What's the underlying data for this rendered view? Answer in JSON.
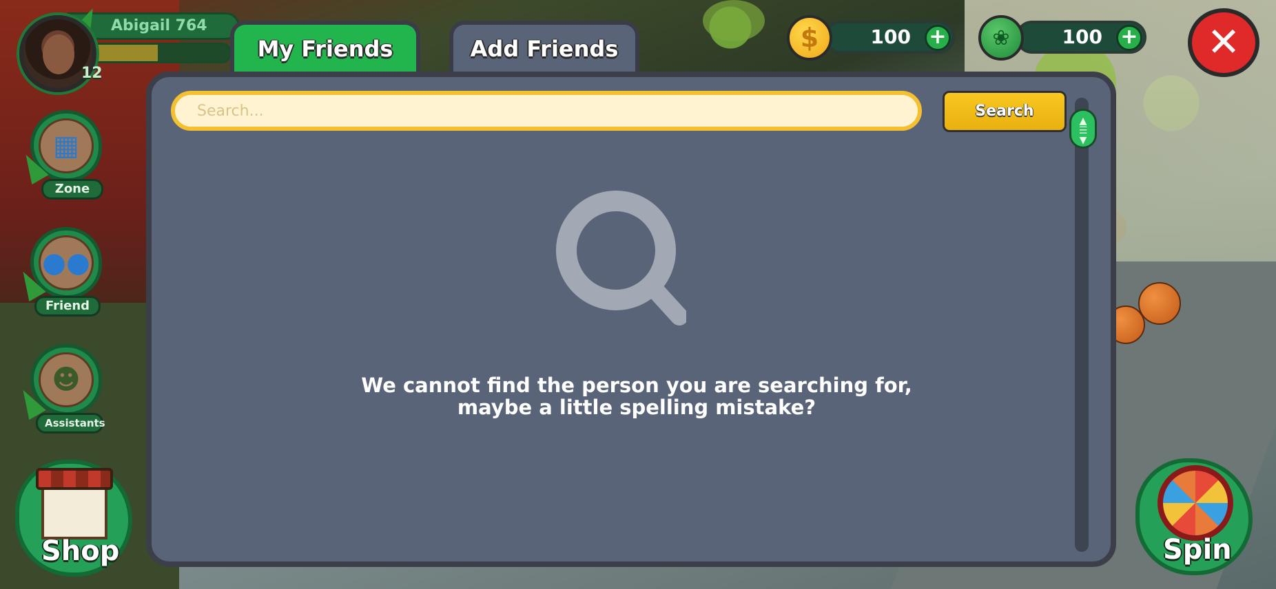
{
  "player": {
    "name": "Abigail 764",
    "level": "12",
    "xp_progress": 0.55
  },
  "sidebar": {
    "zone_label": "Zone",
    "friend_label": "Friend",
    "assistants_label": "Assistants",
    "shop_label": "Shop"
  },
  "currency": {
    "coins": "100",
    "weed": "100"
  },
  "tabs": [
    {
      "label": "My Friends",
      "active": true
    },
    {
      "label": "Add Friends",
      "active": false
    }
  ],
  "search": {
    "placeholder": "Search...",
    "value": "",
    "button_label": "Search"
  },
  "empty_state": {
    "message": "We cannot find the person you are searching for, maybe a little spelling mistake?"
  },
  "spin_label": "Spin",
  "icons": {
    "close": "close-icon",
    "coin": "dollar-coin-icon",
    "weed": "cannabis-leaf-icon",
    "plus": "plus-icon",
    "magnifier": "search-icon",
    "scroll": "scroll-arrows-icon"
  },
  "colors": {
    "tab_active": "#22b54e",
    "panel_bg": "#5a6478",
    "search_border": "#f4c030",
    "search_button": "#f9c820",
    "close_button": "#e02a2a"
  }
}
